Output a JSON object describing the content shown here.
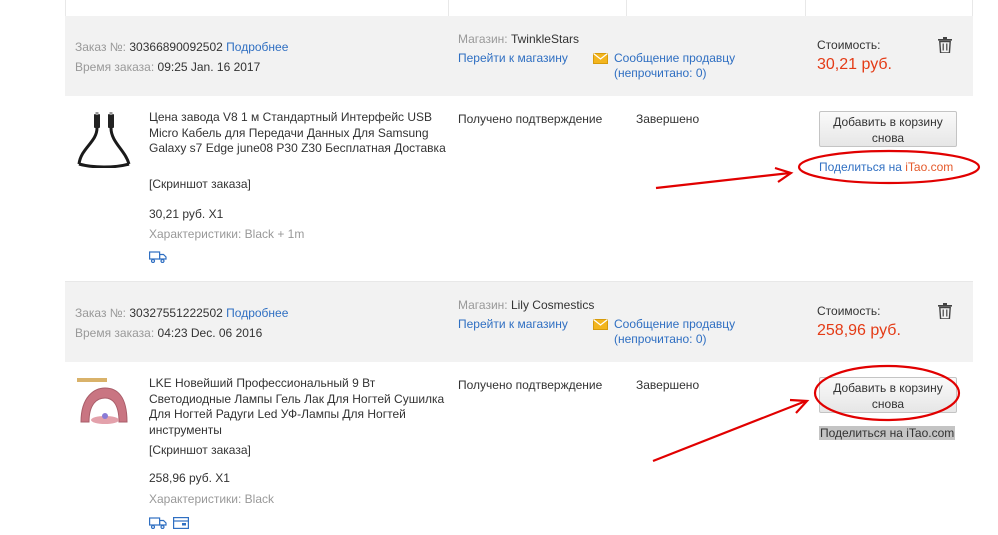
{
  "orders": [
    {
      "order_label": "Заказ №:",
      "order_number": "30366890092502",
      "details_link": "Подробнее",
      "time_label": "Время заказа:",
      "time_value": "09:25 Jan. 16 2017",
      "store_label": "Магазин:",
      "store_name": "TwinkleStars",
      "go_store": "Перейти к магазину",
      "message_seller": "Сообщение продавцу",
      "unread_label": "(непрочитано:",
      "unread_count": "0",
      "unread_close": ")",
      "cost_label": "Стоимость:",
      "cost_value": "30,21 руб.",
      "item_title": "Цена завода V8 1 м Стандартный Интерфейс USB Micro Кабель для Передачи Данных Для Samsung Galaxy s7 Edge june08 P30 Z30 Бесплатная Доставка",
      "screenshot_link": "[Скриншот заказа]",
      "item_price": "30,21 руб. X1",
      "characteristics": "Характеристики: Black + 1m",
      "status_confirm": "Получено подтверждение",
      "status_done": "Завершено",
      "add_to_cart": "Добавить в корзину снова",
      "share_prefix": "Поделиться на ",
      "share_brand": "iTao.com"
    },
    {
      "order_label": "Заказ №:",
      "order_number": "30327551222502",
      "details_link": "Подробнее",
      "time_label": "Время заказа:",
      "time_value": "04:23 Dec. 06 2016",
      "store_label": "Магазин:",
      "store_name": "Lily Cosmestics",
      "go_store": "Перейти к магазину",
      "message_seller": "Сообщение продавцу",
      "unread_label": "(непрочитано:",
      "unread_count": "0",
      "unread_close": ")",
      "cost_label": "Стоимость:",
      "cost_value": "258,96 руб.",
      "item_title": "LKE Новейший Профессиональный 9 Вт Светодиодные Лампы Гель Лак Для Ногтей Сушилка Для Ногтей Радуги Led УФ-Лампы Для Ногтей инструменты",
      "screenshot_link": "[Скриншот заказа]",
      "item_price": "258,96 руб. X1",
      "characteristics": "Характеристики: Black",
      "status_confirm": "Получено подтверждение",
      "status_done": "Завершено",
      "add_to_cart": "Добавить в корзину снова",
      "share_prefix": "Поделиться на ",
      "share_brand": "iTao.com"
    }
  ],
  "colors": {
    "link": "#2f6fc2",
    "price": "#e43b16",
    "header_bg": "#f2f2f2",
    "annotation": "#e10000"
  },
  "icons": [
    "trash-icon",
    "mail-icon",
    "truck-icon",
    "wallet-icon",
    "usb-cable-image",
    "nail-lamp-image"
  ]
}
